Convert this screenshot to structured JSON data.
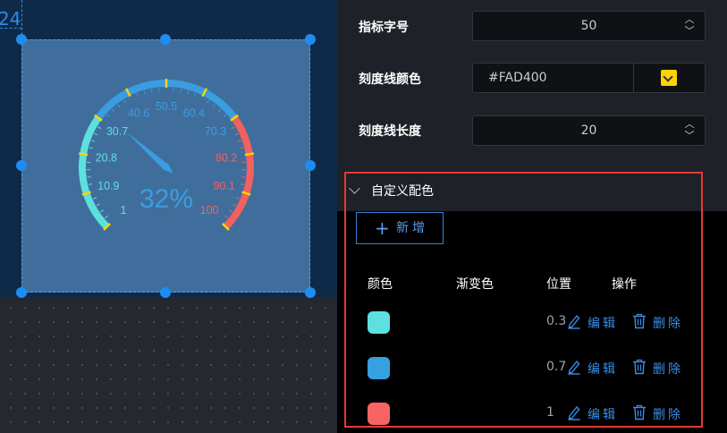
{
  "canvas": {
    "ruler_number": "24",
    "gauge": {
      "value_text": "32%",
      "value_percent": 32,
      "ticks": [
        "1",
        "10.9",
        "20.8",
        "30.7",
        "40.6",
        "50.5",
        "60.4",
        "70.3",
        "80.2",
        "90.1",
        "100"
      ],
      "colors": {
        "tick_line": "#FAD400",
        "seg1": "#5ee0dc",
        "seg2": "#3a9de0",
        "seg3": "#f2605f",
        "pointer": "#3a9de0"
      }
    }
  },
  "panel": {
    "font_size": {
      "label": "指标字号",
      "value": "50"
    },
    "tick_color": {
      "label": "刻度线颜色",
      "value": "#FAD400"
    },
    "tick_length": {
      "label": "刻度线长度",
      "value": "20"
    },
    "custom_colors": {
      "title": "自定义配色",
      "add_button": "新增",
      "columns": {
        "color": "颜色",
        "gradient": "渐变色",
        "position": "位置",
        "actions": "操作"
      },
      "rows": [
        {
          "color": "#5ee0e0",
          "position": "0.3",
          "edit": "编辑",
          "delete": "删除"
        },
        {
          "color": "#35a1e0",
          "position": "0.7",
          "edit": "编辑",
          "delete": "删除"
        },
        {
          "color": "#f86364",
          "position": "1",
          "edit": "编辑",
          "delete": "删除"
        }
      ]
    }
  }
}
